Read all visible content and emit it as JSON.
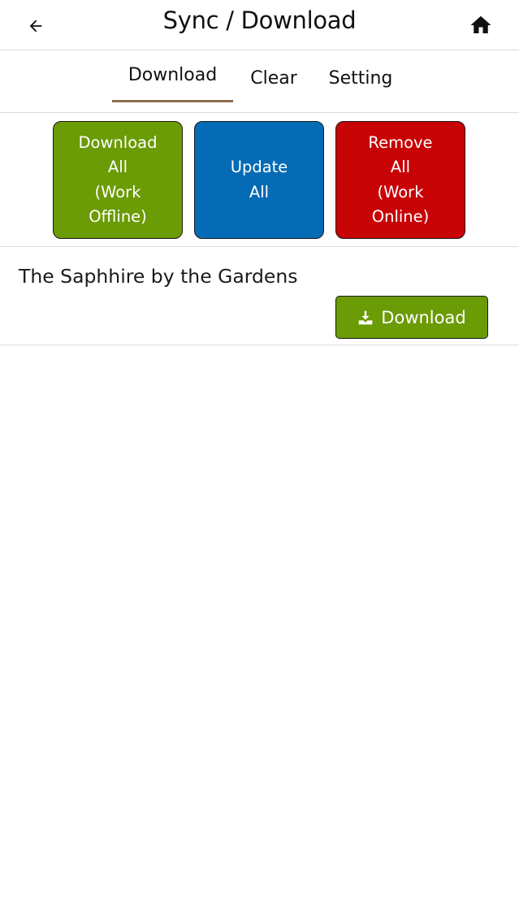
{
  "header": {
    "title": "Sync / Download",
    "back_icon": "arrow-left-icon",
    "home_icon": "home-icon"
  },
  "tabs": [
    {
      "label": "Download",
      "active": true
    },
    {
      "label": "Clear",
      "active": false
    },
    {
      "label": "Setting",
      "active": false
    }
  ],
  "actions": {
    "download_all": {
      "lines": [
        "Download",
        "All",
        "(Work",
        "Offline)"
      ],
      "color": "#6b9b05"
    },
    "update_all": {
      "lines": [
        "Update",
        "All"
      ],
      "color": "#066bb5"
    },
    "remove_all": {
      "lines": [
        "Remove",
        "All",
        "(Work",
        "Online)"
      ],
      "color": "#c80306"
    }
  },
  "list": {
    "items": [
      {
        "title": "The Saphhire by the Gardens",
        "button_label": "Download",
        "button_icon": "download-icon"
      }
    ]
  },
  "colors": {
    "tab_indicator": "#8b6f4e",
    "divider": "#dcdcdc"
  }
}
